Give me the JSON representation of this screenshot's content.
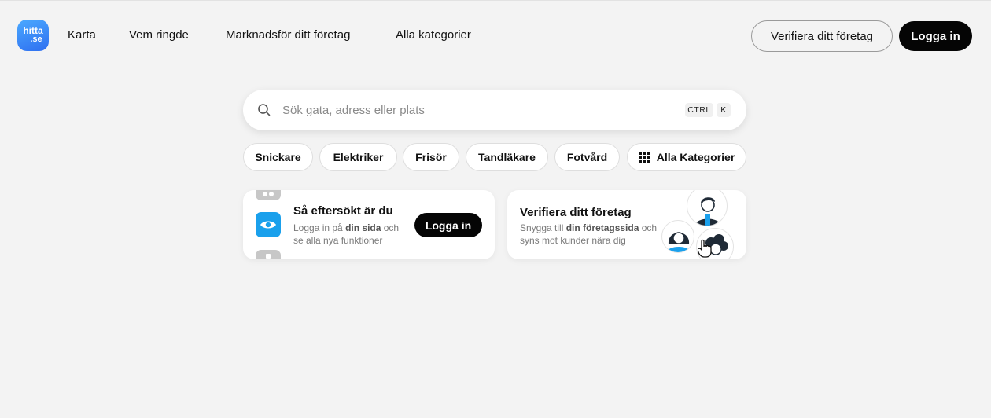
{
  "header": {
    "logo": {
      "line1": "hitta",
      "line2": ".se"
    },
    "nav": [
      "Karta",
      "Vem ringde",
      "Marknadsför ditt företag",
      "Alla kategorier"
    ],
    "verify_label": "Verifiera ditt företag",
    "login_label": "Logga in"
  },
  "search": {
    "placeholder": "Sök gata, adress eller plats",
    "value": "",
    "shortcut_ctrl": "CTRL",
    "shortcut_key": "K"
  },
  "chips": [
    "Snickare",
    "Elektriker",
    "Frisör",
    "Tandläkare",
    "Fotvård"
  ],
  "all_categories_chip": "Alla Kategorier",
  "card_searched": {
    "title": "Så eftersökt är du",
    "text_before": "Logga in på ",
    "text_bold": "din sida",
    "text_after": " och",
    "text_line2": "se alla nya funktioner",
    "button": "Logga in"
  },
  "card_verify": {
    "title": "Verifiera ditt företag",
    "text_before": "Snygga till ",
    "text_bold": "din företagssida",
    "text_after": " och",
    "text_line2": "syns mot kunder nära dig"
  },
  "colors": {
    "background": "#f3f3f3",
    "accent_blue": "#1aa0ec",
    "logo_blue": "#2f6ff0",
    "button_dark": "#050505"
  },
  "icons": [
    "search-icon",
    "grid-icon",
    "eye-icon",
    "glasses-icon",
    "hand-cursor-icon"
  ]
}
